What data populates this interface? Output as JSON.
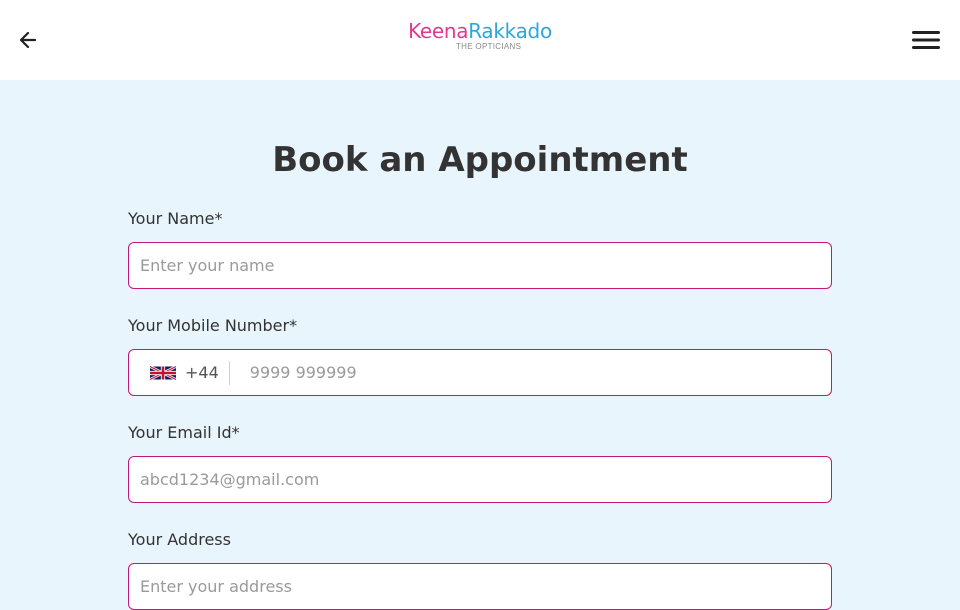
{
  "header": {
    "logo_primary": "Keena",
    "logo_secondary": "Rakkado",
    "logo_tagline": "THE OPTICIANS",
    "back_icon": "arrow-left-icon",
    "menu_icon": "hamburger-menu-icon"
  },
  "page": {
    "title": "Book an Appointment"
  },
  "form": {
    "name": {
      "label": "Your Name*",
      "placeholder": "Enter your name",
      "value": ""
    },
    "mobile": {
      "label": "Your Mobile Number*",
      "country_flag": "uk-flag-icon",
      "country_code": "+44",
      "placeholder": "9999 999999",
      "value": ""
    },
    "email": {
      "label": "Your Email Id*",
      "placeholder": "abcd1234@gmail.com",
      "value": ""
    },
    "address": {
      "label": "Your Address",
      "placeholder": "Enter your address",
      "value": ""
    }
  },
  "colors": {
    "accent_border": "#c2187a",
    "background": "#e8f5fd",
    "logo_pink": "#e2398f",
    "logo_blue": "#2ea6d9"
  }
}
